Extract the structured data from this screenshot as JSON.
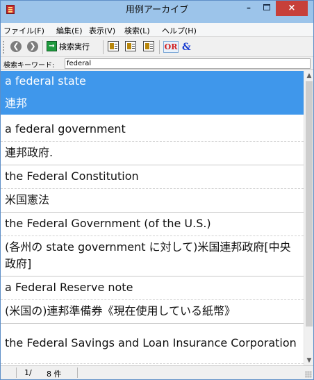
{
  "window": {
    "title": "用例アーカイブ",
    "controls": {
      "minimize": "–",
      "close": "×"
    }
  },
  "menu": [
    "ファイル(F)",
    "編集(E)",
    "表示(V)",
    "検索(L)",
    "ヘルプ(H)"
  ],
  "toolbar": {
    "back_icon": "back-arrow-icon",
    "forward_icon": "forward-arrow-icon",
    "run_search_label": "検索実行",
    "or_label": "OR",
    "and_label": "&"
  },
  "search": {
    "label": "検索キーワード:",
    "value": "federal"
  },
  "results": [
    {
      "text": "a federal state",
      "selected": true
    },
    {
      "text": "連邦",
      "selected": true
    },
    {
      "text": "a federal government",
      "selected": false
    },
    {
      "text": "連邦政府.",
      "selected": false
    },
    {
      "text": "the Federal Constitution",
      "selected": false
    },
    {
      "text": "米国憲法",
      "selected": false
    },
    {
      "text": "the Federal Government (of the U.S.)",
      "selected": false
    },
    {
      "text": "(各州の state government に対して)米国連邦政府[中央政府]",
      "selected": false
    },
    {
      "text": "a Federal Reserve note",
      "selected": false
    },
    {
      "text": "(米国の)連邦準備券《現在使用している紙幣》",
      "selected": false
    },
    {
      "text": "the Federal Savings and Loan Insurance Corporation",
      "selected": false
    }
  ],
  "status": {
    "page": "1/",
    "count": "8 件"
  },
  "colors": {
    "selection": "#3f97eb",
    "titlebar": "#9cc4ea",
    "close": "#c7403a"
  }
}
